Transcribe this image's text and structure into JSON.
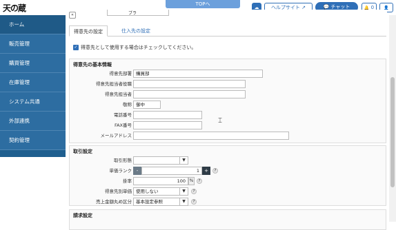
{
  "header": {
    "logo": "天の蔵",
    "top_tab": "TOPへ",
    "help_site": "ヘルプサイト",
    "chat": "チャット",
    "notifications_count": "0",
    "collapse_label": "«"
  },
  "sidebar": {
    "items": [
      {
        "label": "ホーム"
      },
      {
        "label": "販売管理"
      },
      {
        "label": "購買管理"
      },
      {
        "label": "在庫管理"
      },
      {
        "label": "システム共通"
      },
      {
        "label": "外部連携"
      },
      {
        "label": "契約管理"
      }
    ]
  },
  "main": {
    "top_field_label": "ブラ",
    "tabs": [
      {
        "label": "得意先の設定"
      },
      {
        "label": "仕入先の設定"
      }
    ],
    "checkbox_label": "得意先として使用する場合はチェックしてください。",
    "basic": {
      "title": "得意先の基本情報",
      "department_label": "得意先部署",
      "department_value": "購買部",
      "contact_title_label": "得意先担当者役職",
      "contact_title_value": "",
      "contact_name_label": "得意先担当者",
      "contact_name_value": "",
      "honorific_label": "敬称",
      "honorific_value": "御中",
      "phone_label": "電話番号",
      "phone_value": "",
      "fax_label": "FAX番号",
      "fax_value": "",
      "email_label": "メールアドレス",
      "email_value": ""
    },
    "trade": {
      "title": "取引設定",
      "trade_type_label": "取引形態",
      "trade_type_value": "",
      "price_rank_label": "単価ランク",
      "price_rank_value": "1",
      "minus": "-",
      "plus": "+",
      "rate_label": "掛率",
      "rate_value": "100",
      "rate_unit": "%",
      "customer_price_label": "得意先別単価",
      "customer_price_value": "使用しない",
      "rounding_label": "売上金額丸め区分",
      "rounding_value": "基本設定参照"
    },
    "billing": {
      "title": "請求設定"
    }
  },
  "icons": {
    "help": "?",
    "arrow": "▼",
    "cloud": "☁",
    "bell": "🔔",
    "user": "👤"
  }
}
